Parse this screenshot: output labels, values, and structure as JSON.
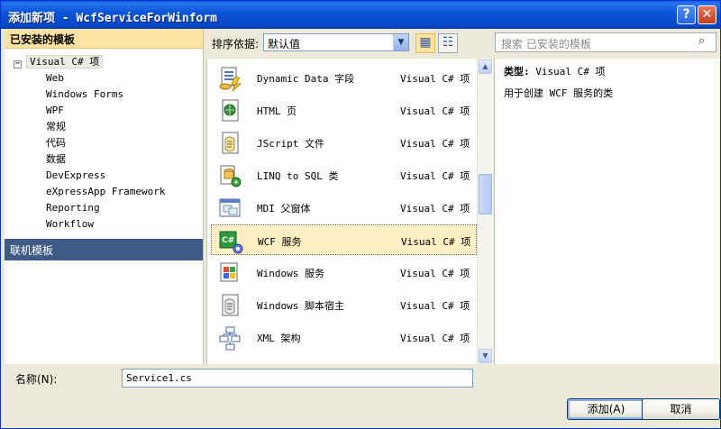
{
  "window": {
    "title": "添加新项 - WcfServiceForWinform"
  },
  "left_panel": {
    "installed_header": "已安装的模板",
    "tree_root": "Visual C# 项",
    "tree_children": [
      "Web",
      "Windows Forms",
      "WPF",
      "常规",
      "代码",
      "数据",
      "DevExpress",
      "eXpressApp Framework",
      "Reporting",
      "Workflow"
    ],
    "online_header": "联机模板"
  },
  "sortbar": {
    "label": "排序依据:",
    "selected": "默认值"
  },
  "search": {
    "placeholder": "搜索 已安装的模板"
  },
  "items": [
    {
      "name": "Dynamic Data 字段",
      "lang": "Visual C# 项",
      "icon": "dynamic-data-field-icon"
    },
    {
      "name": "HTML 页",
      "lang": "Visual C# 项",
      "icon": "html-page-icon"
    },
    {
      "name": "JScript 文件",
      "lang": "Visual C# 项",
      "icon": "jscript-file-icon"
    },
    {
      "name": "LINQ to SQL 类",
      "lang": "Visual C# 项",
      "icon": "linq-to-sql-icon"
    },
    {
      "name": "MDI 父窗体",
      "lang": "Visual C# 项",
      "icon": "mdi-parent-form-icon"
    },
    {
      "name": "WCF 服务",
      "lang": "Visual C# 项",
      "icon": "wcf-service-icon",
      "selected": true
    },
    {
      "name": "Windows 服务",
      "lang": "Visual C# 项",
      "icon": "windows-service-icon"
    },
    {
      "name": "Windows 脚本宿主",
      "lang": "Visual C# 项",
      "icon": "windows-script-host-icon"
    },
    {
      "name": "XML 架构",
      "lang": "Visual C# 项",
      "icon": "xml-schema-icon"
    }
  ],
  "details": {
    "type_label": "类型:",
    "type_value": "Visual C# 项",
    "description": "用于创建 WCF 服务的类"
  },
  "name_row": {
    "label": "名称(N):",
    "value": "Service1.cs"
  },
  "buttons": {
    "add": "添加(A)",
    "cancel": "取消"
  }
}
